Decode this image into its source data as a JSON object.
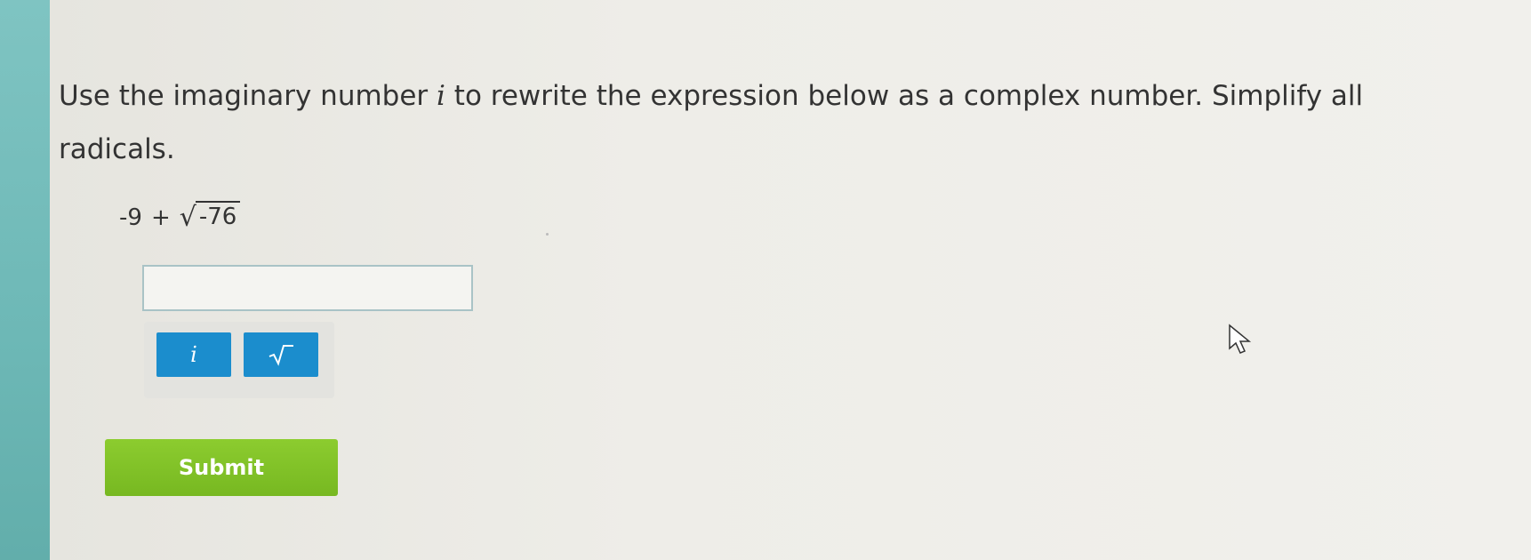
{
  "question": {
    "text_before": "Use the imaginary number ",
    "imaginary_symbol": "i",
    "text_after": " to rewrite the expression below as a complex number. Simplify all radicals."
  },
  "expression": {
    "constant": "-9",
    "operator": "+",
    "radicand": "-76"
  },
  "answer_input": {
    "value": ""
  },
  "keypad": {
    "imaginary_key_label": "i",
    "sqrt_key_icon": "square-root-icon"
  },
  "submit_label": "Submit",
  "colors": {
    "accent_blue": "#1b8dcd",
    "submit_green": "#7fbf26",
    "sidebar_teal": "#6db8b6"
  }
}
